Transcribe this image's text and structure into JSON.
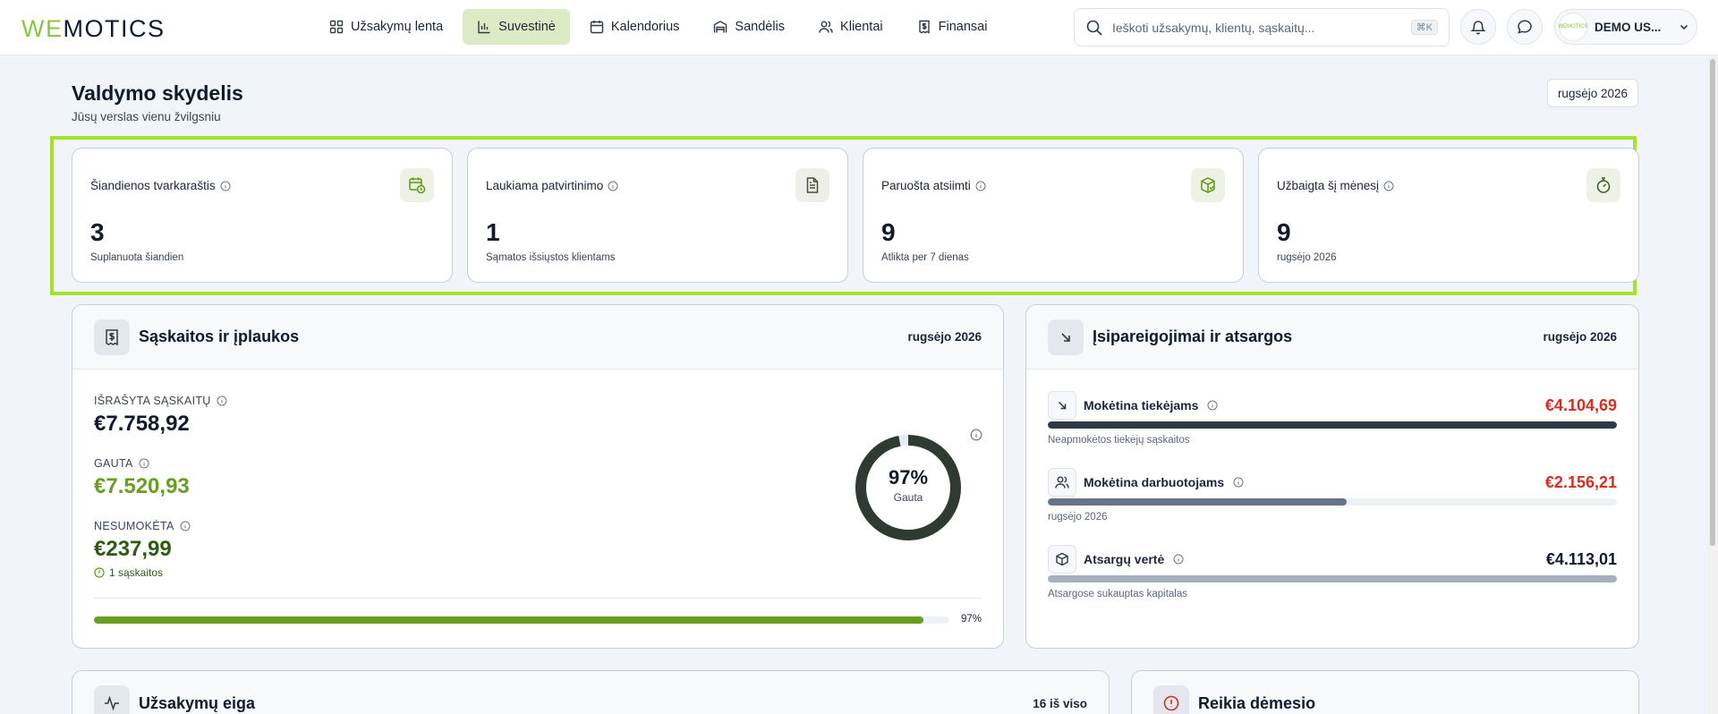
{
  "logo": {
    "part1": "WE",
    "part2": "MOTICS"
  },
  "nav": {
    "items": [
      {
        "label": "Užsakymų lenta",
        "icon": "grid-icon"
      },
      {
        "label": "Suvestinė",
        "icon": "bar-chart-icon",
        "active": true
      },
      {
        "label": "Kalendorius",
        "icon": "calendar-icon"
      },
      {
        "label": "Sandėlis",
        "icon": "warehouse-icon"
      },
      {
        "label": "Klientai",
        "icon": "users-icon"
      },
      {
        "label": "Finansai",
        "icon": "receipt-icon"
      }
    ]
  },
  "search": {
    "placeholder": "Ieškoti užsakymų, klientų, sąskaitų...",
    "shortcut": "⌘K"
  },
  "user": {
    "name": "DEMO US...",
    "avatar_text": "WEMOTICS"
  },
  "header": {
    "title": "Valdymo skydelis",
    "subtitle": "Jūsų verslas vienu žvilgsniu",
    "month": "rugsėjo 2026"
  },
  "kpis": [
    {
      "label": "Šiandienos tvarkaraštis",
      "value": "3",
      "sub": "Suplanuota šiandien",
      "icon": "calendar-clock-icon"
    },
    {
      "label": "Laukiama patvirtinimo",
      "value": "1",
      "sub": "Sąmatos išsiųstos klientams",
      "icon": "document-icon"
    },
    {
      "label": "Paruošta atsiimti",
      "value": "9",
      "sub": "Atlikta per 7 dienas",
      "icon": "package-check-icon"
    },
    {
      "label": "Užbaigta šį mėnesį",
      "value": "9",
      "sub": "rugsėjo 2026",
      "icon": "stopwatch-icon"
    }
  ],
  "invoices": {
    "title": "Sąskaitos ir įplaukos",
    "period": "rugsėjo 2026",
    "issued_label": "IŠRAŠYTA SĄSKAITŲ",
    "issued_value": "€7.758,92",
    "received_label": "GAUTA",
    "received_value": "€7.520,93",
    "unpaid_label": "NESUMOKĖTA",
    "unpaid_value": "€237,99",
    "unpaid_count": "1 sąskaitos",
    "donut_pct": "97%",
    "donut_label": "Gauta",
    "donut_fraction": 0.97,
    "progress_fraction": 0.97,
    "progress_text": "97%"
  },
  "liabilities": {
    "title": "Įsipareigojimai ir atsargos",
    "period": "rugsėjo 2026",
    "rows": [
      {
        "name": "Mokėtina tiekėjams",
        "amount": "€4.104,69",
        "sub": "Neapmokėtos tiekėjų sąskaitos",
        "fraction": 1.0,
        "icon": "arrow-down-right-icon"
      },
      {
        "name": "Mokėtina darbuotojams",
        "amount": "€2.156,21",
        "sub": "rugsėjo 2026",
        "fraction": 0.525,
        "icon": "users-icon"
      },
      {
        "name": "Atsargų vertė",
        "amount": "€4.113,01",
        "sub": "Atsargose sukauptas kapitalas",
        "fraction": 1.0,
        "icon": "box-icon"
      }
    ]
  },
  "orders_flow": {
    "title": "Užsakymų eiga",
    "count": "16 iš viso"
  },
  "attention": {
    "title": "Reikia dėmesio"
  },
  "colors": {
    "brand_green": "#8cc63f",
    "positive_green": "#6a9e1e",
    "dark_green": "#2f5a13",
    "danger_red": "#d92d20",
    "slate": "#2f3a47"
  }
}
